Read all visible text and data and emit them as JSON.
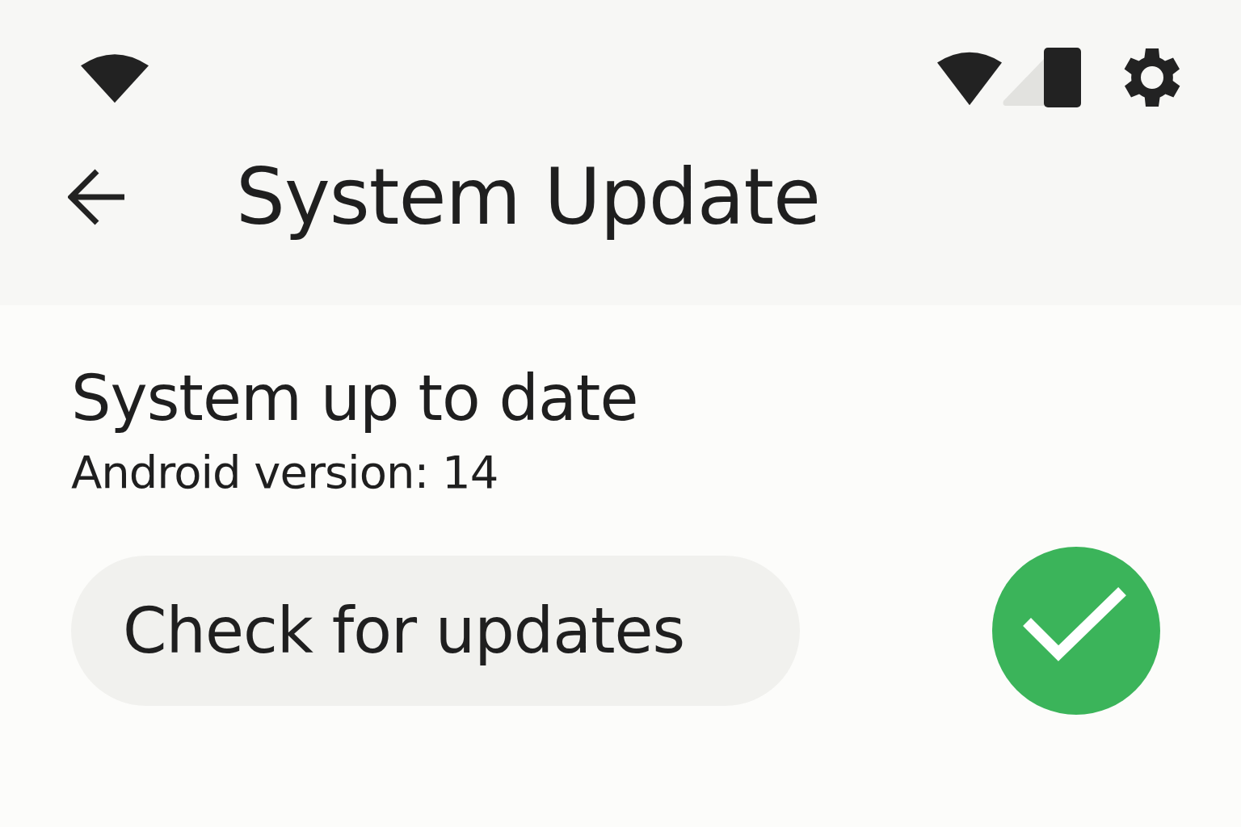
{
  "app_bar": {
    "title": "System Update"
  },
  "status": {
    "heading": "System up to date",
    "version": "Android version: 14"
  },
  "buttons": [
    {
      "label": "Check for updates"
    }
  ]
}
